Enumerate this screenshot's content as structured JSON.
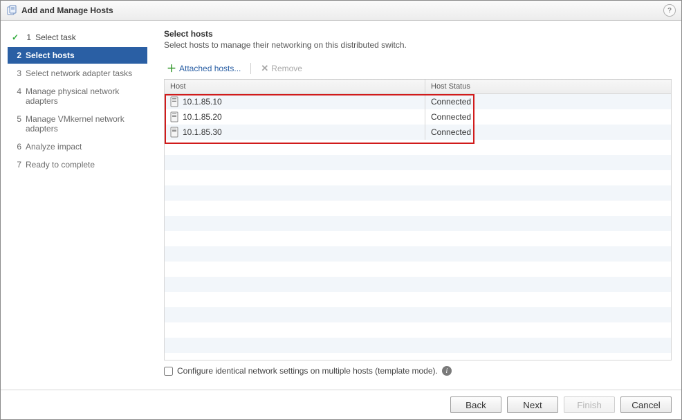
{
  "window": {
    "title": "Add and Manage Hosts"
  },
  "sidebar": {
    "steps": [
      {
        "num": "1",
        "label": "Select task",
        "state": "completed"
      },
      {
        "num": "2",
        "label": "Select hosts",
        "state": "active"
      },
      {
        "num": "3",
        "label": "Select network adapter tasks",
        "state": "pending"
      },
      {
        "num": "4",
        "label": "Manage physical network adapters",
        "state": "pending"
      },
      {
        "num": "5",
        "label": "Manage VMkernel network adapters",
        "state": "pending"
      },
      {
        "num": "6",
        "label": "Analyze impact",
        "state": "pending"
      },
      {
        "num": "7",
        "label": "Ready to complete",
        "state": "pending"
      }
    ]
  },
  "main": {
    "heading": "Select hosts",
    "subheading": "Select hosts to manage their networking on this distributed switch.",
    "toolbar": {
      "attached_label": "Attached hosts...",
      "remove_label": "Remove"
    },
    "columns": {
      "host": "Host",
      "status": "Host Status"
    },
    "rows": [
      {
        "host": "10.1.85.10",
        "status": "Connected"
      },
      {
        "host": "10.1.85.20",
        "status": "Connected"
      },
      {
        "host": "10.1.85.30",
        "status": "Connected"
      }
    ],
    "template_label": "Configure identical network settings on multiple hosts (template mode)."
  },
  "footer": {
    "back": "Back",
    "next": "Next",
    "finish": "Finish",
    "cancel": "Cancel"
  }
}
